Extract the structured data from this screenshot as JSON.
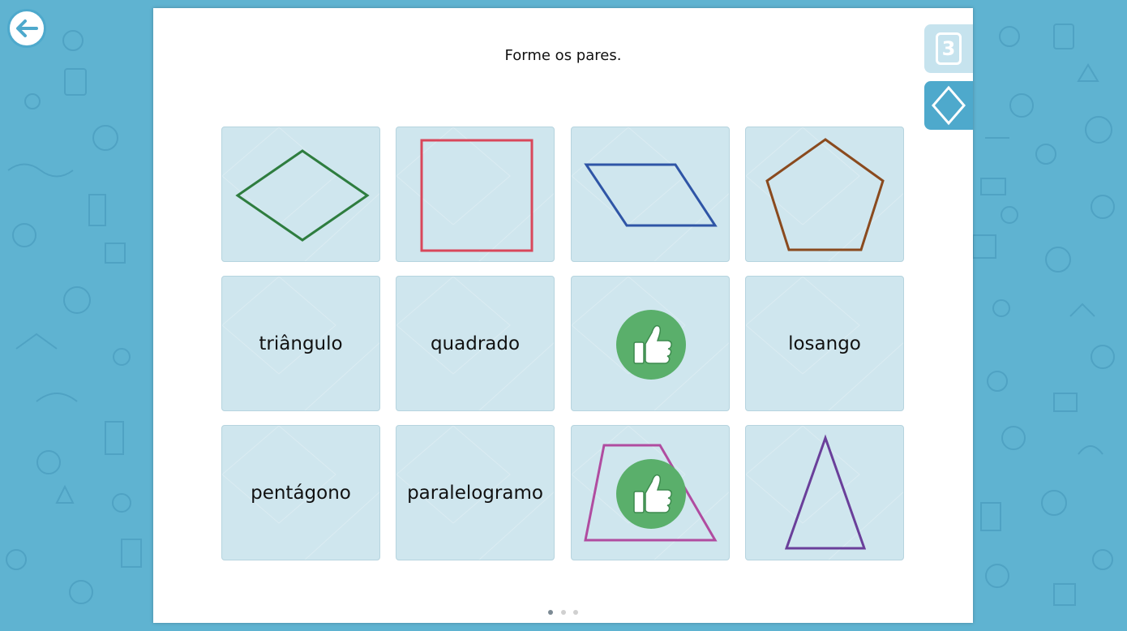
{
  "app": {
    "background_color": "#5fb3d1",
    "accent_color": "#4ea9cc",
    "back_icon": "arrow-left-icon"
  },
  "instruction": "Forme os pares.",
  "side_tabs": {
    "count": "3",
    "shape_icon": "diamond-icon"
  },
  "cards": [
    {
      "kind": "shape",
      "shape": "rhombus",
      "color": "#2e7d3f"
    },
    {
      "kind": "shape",
      "shape": "square",
      "color": "#d9475a"
    },
    {
      "kind": "shape",
      "shape": "parallelogram",
      "color": "#2f55a6"
    },
    {
      "kind": "shape",
      "shape": "pentagon",
      "color": "#8a4a1e"
    },
    {
      "kind": "word",
      "label": "triângulo"
    },
    {
      "kind": "word",
      "label": "quadrado"
    },
    {
      "kind": "matched",
      "icon": "thumbs-up-icon",
      "color": "#5aaf6b"
    },
    {
      "kind": "word",
      "label": "losango"
    },
    {
      "kind": "word",
      "label": "pentágono"
    },
    {
      "kind": "word",
      "label": "paralelogramo"
    },
    {
      "kind": "shape-matched",
      "shape": "trapezoid",
      "color": "#b04ca0",
      "icon": "thumbs-up-icon"
    },
    {
      "kind": "shape",
      "shape": "triangle",
      "color": "#6a3f9a"
    }
  ],
  "pagination": {
    "total": 3,
    "active": 1
  }
}
